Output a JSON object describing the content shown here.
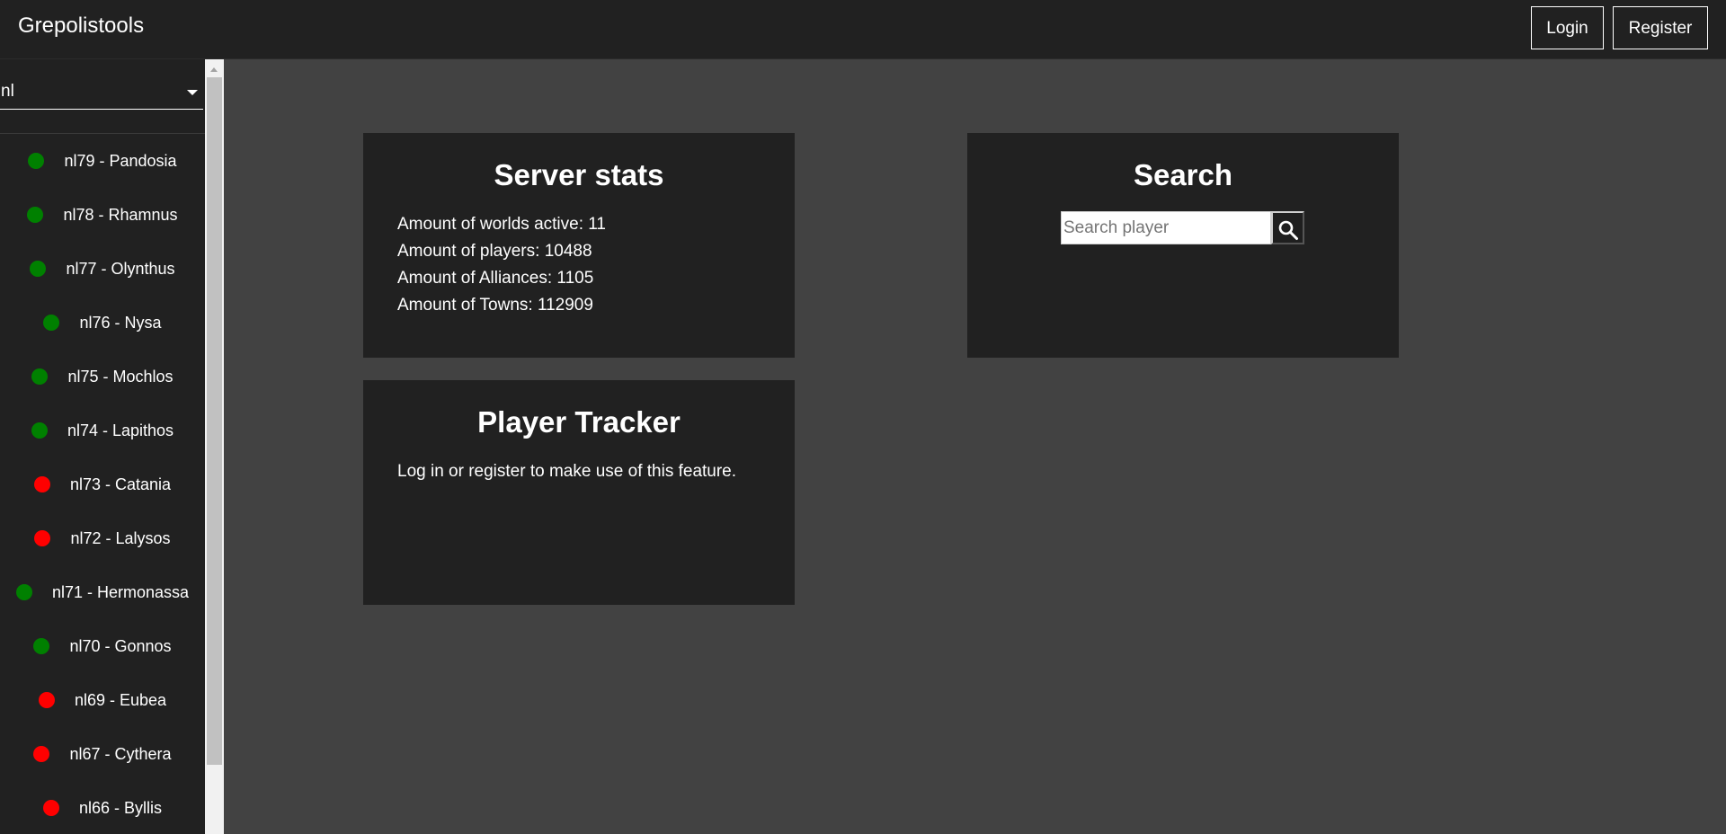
{
  "header": {
    "brand": "Grepolistools",
    "login_label": "Login",
    "register_label": "Register"
  },
  "sidebar": {
    "selected_server": "nl",
    "worlds": [
      {
        "label": "nl79 - Pandosia",
        "status": "active"
      },
      {
        "label": "nl78 - Rhamnus",
        "status": "active"
      },
      {
        "label": "nl77 - Olynthus",
        "status": "active"
      },
      {
        "label": "nl76 - Nysa",
        "status": "active"
      },
      {
        "label": "nl75 - Mochlos",
        "status": "active"
      },
      {
        "label": "nl74 - Lapithos",
        "status": "active"
      },
      {
        "label": "nl73 - Catania",
        "status": "inactive"
      },
      {
        "label": "nl72 - Lalysos",
        "status": "inactive"
      },
      {
        "label": "nl71 - Hermonassa",
        "status": "active"
      },
      {
        "label": "nl70 - Gonnos",
        "status": "active"
      },
      {
        "label": "nl69 - Eubea",
        "status": "inactive"
      },
      {
        "label": "nl67 - Cythera",
        "status": "inactive"
      },
      {
        "label": "nl66 - Byllis",
        "status": "inactive"
      }
    ]
  },
  "status_colors": {
    "active": "#008000",
    "inactive": "#ff0000"
  },
  "server_stats": {
    "title": "Server stats",
    "lines": [
      "Amount of worlds active: 11",
      "Amount of players: 10488",
      "Amount of Alliances: 1105",
      "Amount of Towns: 112909"
    ]
  },
  "search": {
    "title": "Search",
    "placeholder": "Search player",
    "value": "",
    "button_icon": "search-icon"
  },
  "player_tracker": {
    "title": "Player Tracker",
    "message": "Log in or register to make use of this feature."
  }
}
